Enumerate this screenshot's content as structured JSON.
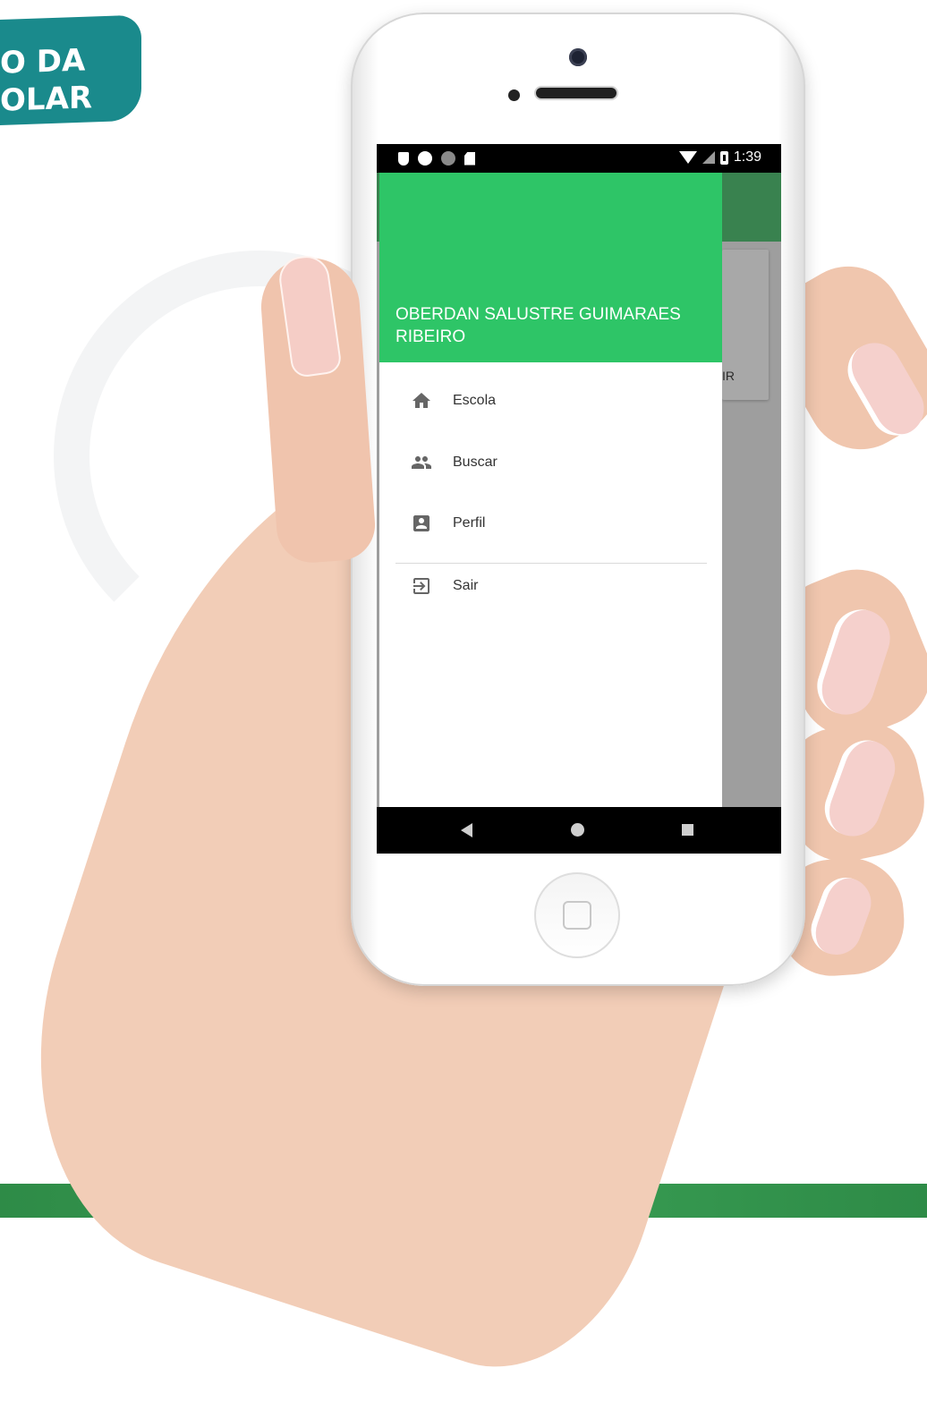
{
  "logo": {
    "line1": "O DA",
    "line2": "OLAR",
    "color": "#1a8a8c"
  },
  "status_bar": {
    "time": "1:39",
    "icons": [
      "shield-icon",
      "circle-icon",
      "circle-gray-icon",
      "sd-card-icon",
      "wifi-icon",
      "signal-icon",
      "battery-icon"
    ]
  },
  "app_behind": {
    "card_text": "IR"
  },
  "drawer": {
    "header_color": "#2ec567",
    "user_name": "OBERDAN SALUSTRE GUIMARAES RIBEIRO",
    "items": [
      {
        "label": "Escola",
        "icon": "home-icon"
      },
      {
        "label": "Buscar",
        "icon": "people-icon"
      },
      {
        "label": "Perfil",
        "icon": "account-box-icon"
      }
    ],
    "footer_items": [
      {
        "label": "Sair",
        "icon": "logout-icon"
      }
    ]
  },
  "nav_bar": {
    "buttons": [
      "back-icon",
      "home-circle-icon",
      "recents-icon"
    ]
  }
}
